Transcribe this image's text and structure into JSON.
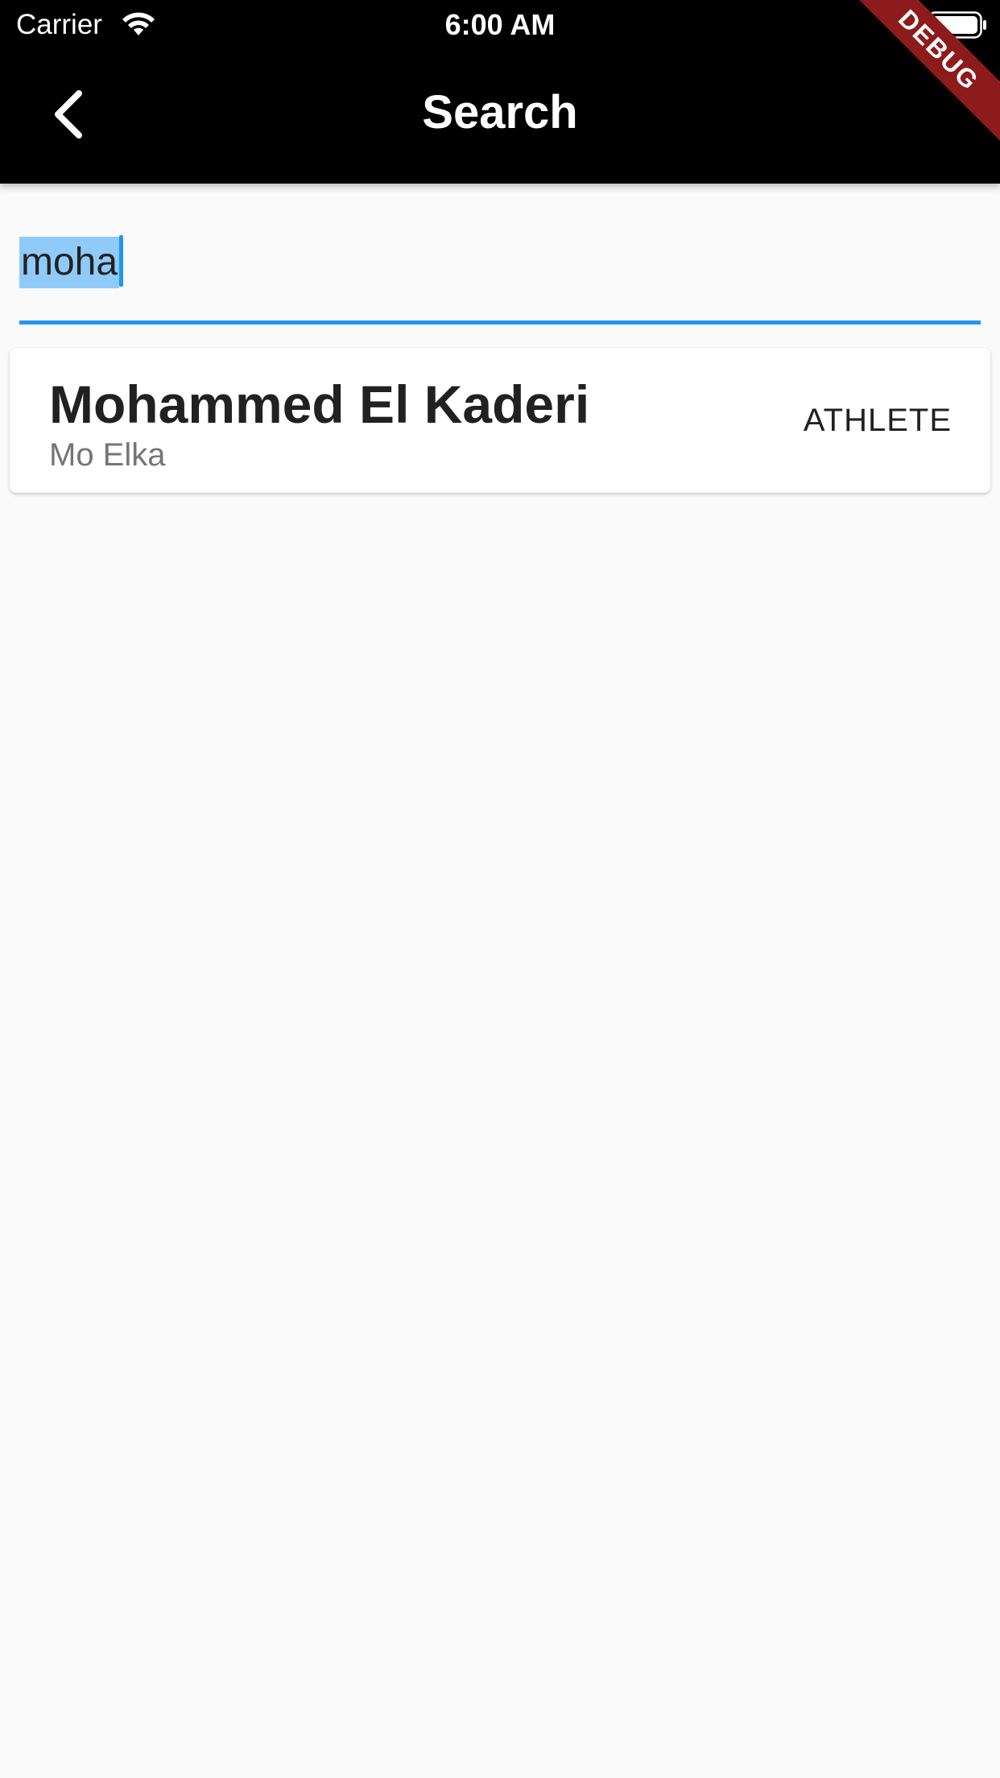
{
  "status_bar": {
    "carrier": "Carrier",
    "time": "6:00 AM",
    "wifi_icon": "wifi-icon",
    "battery_icon": "battery-full-icon"
  },
  "app_bar": {
    "title": "Search",
    "back_icon": "chevron-left-icon",
    "background": "#000000"
  },
  "debug_banner": {
    "label": "DEBUG",
    "color": "#8e1b1b"
  },
  "search": {
    "value": "moha",
    "accent": "#2196f3",
    "selection_color": "#90caf9"
  },
  "results": [
    {
      "name": "Mohammed El Kaderi",
      "nickname": "Mo Elka",
      "role": "ATHLETE"
    }
  ]
}
